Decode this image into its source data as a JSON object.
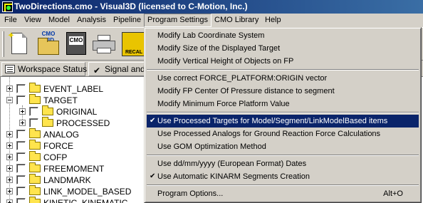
{
  "window": {
    "title": "TwoDirections.cmo - Visual3D (licensed to C-Motion, Inc.)",
    "app_icon": "visual3d-app-icon"
  },
  "menubar": {
    "items": [
      {
        "label": "File"
      },
      {
        "label": "View"
      },
      {
        "label": "Model"
      },
      {
        "label": "Analysis"
      },
      {
        "label": "Pipeline"
      },
      {
        "label": "Program Settings"
      },
      {
        "label": "CMO Library"
      },
      {
        "label": "Help"
      }
    ]
  },
  "toolbar": {
    "buttons": [
      {
        "icon": "new-file-icon"
      },
      {
        "icon": "open-cmo-c3d-icon",
        "caption": "CMO C3D"
      },
      {
        "icon": "cmo-file-icon",
        "caption": "CMO"
      },
      {
        "icon": "printer-icon"
      },
      {
        "icon": "recalc-icon",
        "caption": "RECAL"
      }
    ]
  },
  "tabs": [
    {
      "label": "Workspace Status"
    },
    {
      "label": "Signal and"
    }
  ],
  "tree": {
    "items": [
      {
        "label": "EVENT_LABEL",
        "expanded": false
      },
      {
        "label": "TARGET",
        "expanded": true
      },
      {
        "label": "ORIGINAL",
        "expanded": false
      },
      {
        "label": "PROCESSED",
        "expanded": false
      },
      {
        "label": "ANALOG",
        "expanded": false
      },
      {
        "label": "FORCE",
        "expanded": false
      },
      {
        "label": "COFP",
        "expanded": false
      },
      {
        "label": "FREEMOMENT",
        "expanded": false
      },
      {
        "label": "LANDMARK",
        "expanded": false
      },
      {
        "label": "LINK_MODEL_BASED",
        "expanded": false
      },
      {
        "label": "KINETIC_KINEMATIC",
        "expanded": false
      }
    ]
  },
  "dropdown": {
    "groups": [
      [
        {
          "label": "Modify Lab Coordinate System"
        },
        {
          "label": "Modify Size of the Displayed Target"
        },
        {
          "label": "Modify Vertical Height of Objects on FP"
        }
      ],
      [
        {
          "label": "Use correct FORCE_PLATFORM:ORIGIN vector"
        },
        {
          "label": "Modify FP Center Of Pressure distance to segment"
        },
        {
          "label": "Modify Minimum Force Platform Value"
        }
      ],
      [
        {
          "label": "Use Processed Targets for Model/Segment/LinkModelBased items",
          "checked": true,
          "selected": true
        },
        {
          "label": "Use Processed Analogs for Ground Reaction Force Calculations"
        },
        {
          "label": "Use GOM Optimization Method"
        }
      ],
      [
        {
          "label": "Use dd/mm/yyyy (European Format) Dates"
        },
        {
          "label": "Use Automatic KINARM Segments Creation",
          "checked": true
        }
      ],
      [
        {
          "label": "Program Options...",
          "shortcut": "Alt+O"
        }
      ]
    ],
    "check_glyph": "✔"
  }
}
